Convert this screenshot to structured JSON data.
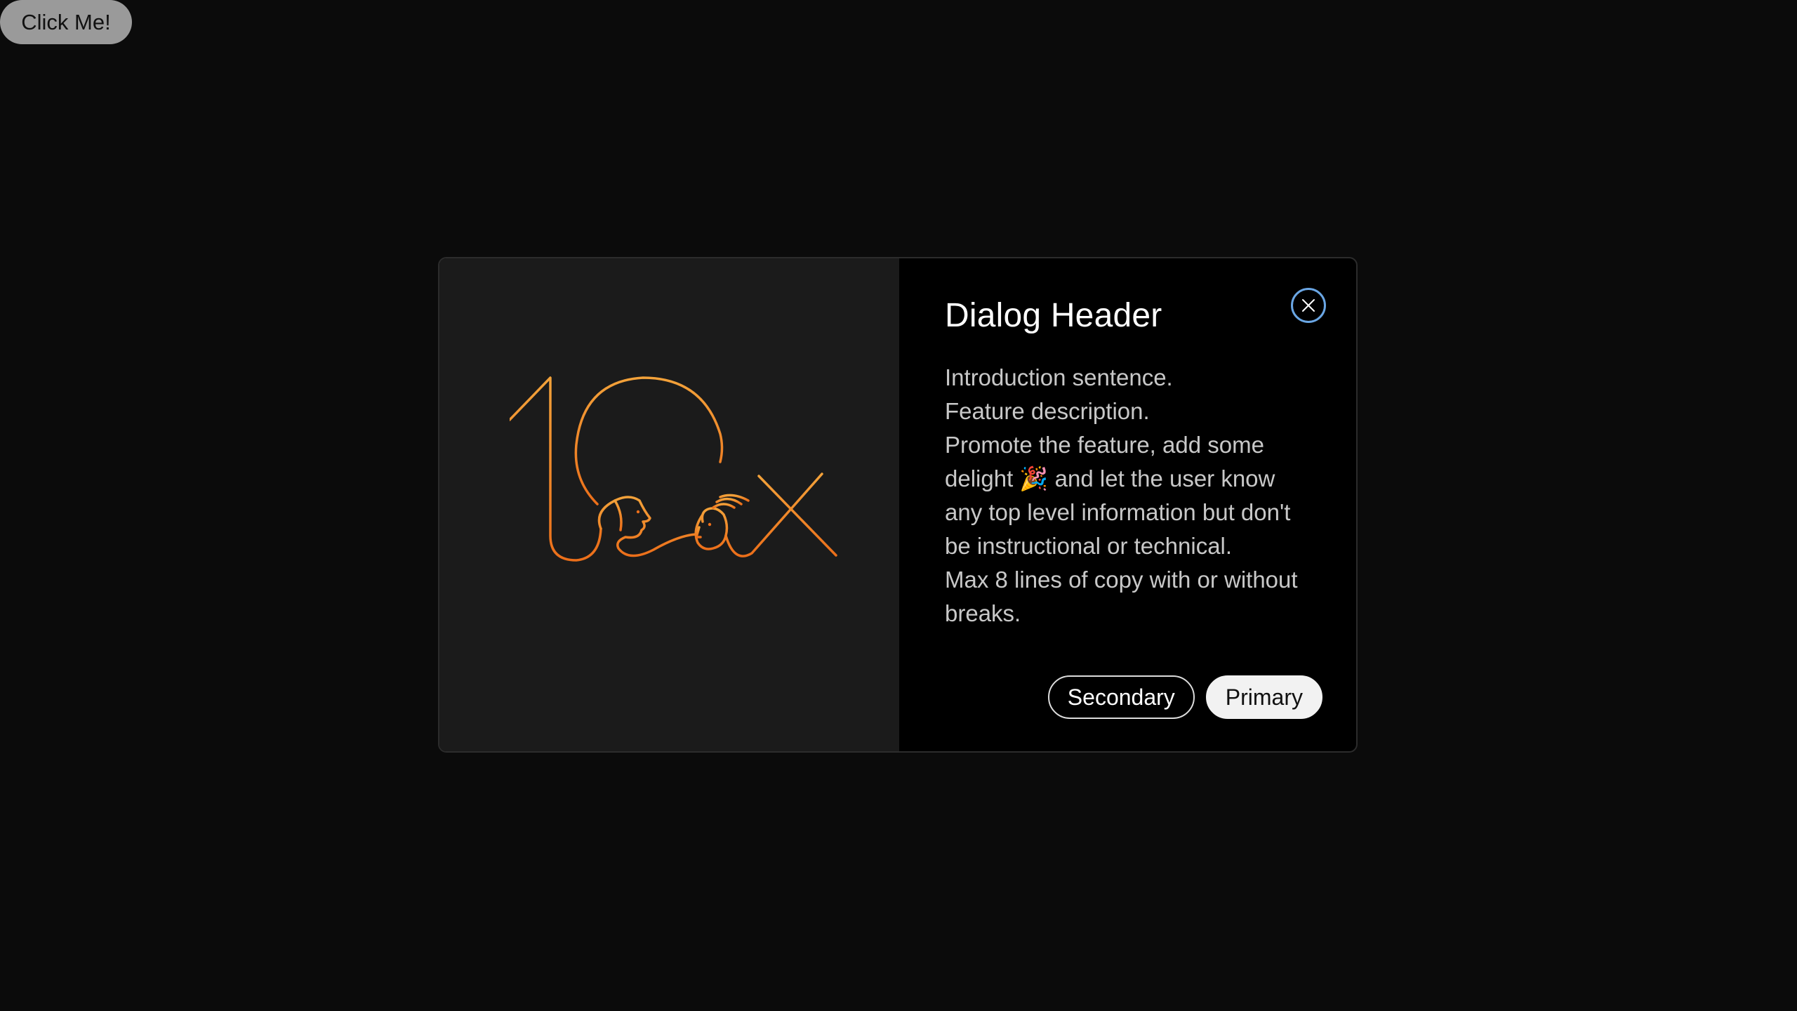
{
  "trigger": {
    "label": "Click Me!"
  },
  "dialog": {
    "title": "Dialog Header",
    "close_icon": "close-icon",
    "illustration_icon": "ten-x-illustration",
    "body_lines": [
      "Introduction sentence.",
      "Feature description.",
      "Promote the feature, add some delight 🎉 and let the user know any top level information but don't be instructional or technical.",
      "Max 8 lines of copy with or without breaks."
    ],
    "secondary_label": "Secondary",
    "primary_label": "Primary"
  },
  "colors": {
    "background": "#0b0b0b",
    "media_panel": "#1b1b1b",
    "accent_orange": "#f08a1c",
    "focus_ring": "#6aa6e4"
  }
}
